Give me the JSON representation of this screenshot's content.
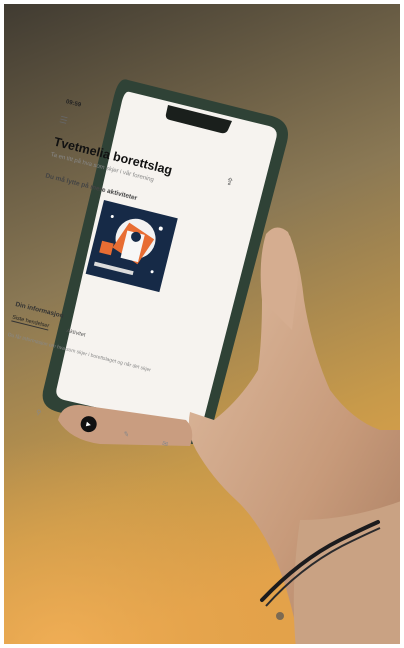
{
  "image": {
    "colors": {
      "wall_top": "#3f3a31",
      "wall_mid": "#8a7854",
      "wall_glow": "#c89a4a",
      "wall_bottom": "#e3a24a",
      "phone_frame": "#2f4236",
      "skin": "#cfa687",
      "bracelet": "#1b1b1d",
      "screen": "#f6f3ef",
      "cover_bg": "#162a47",
      "cover_accent": "#e86d33"
    }
  },
  "phone_screen": {
    "status_time": "09:59",
    "title": "Tvetmelia borettslag",
    "subtitle": "Ta en titt på hva som skjer i vår forening",
    "prompt": "Du må lytte på mere aktiviteter",
    "section_label": "Din informasjon",
    "tabs": [
      "Siste hendelser",
      "Aktivitet"
    ],
    "description": "Du får informasjon om hva som skjer i borettslaget og når det skjer",
    "icons": [
      "menu-icon",
      "share-icon",
      "home-icon",
      "search-icon",
      "play-icon",
      "pencil-icon",
      "message-icon"
    ]
  }
}
